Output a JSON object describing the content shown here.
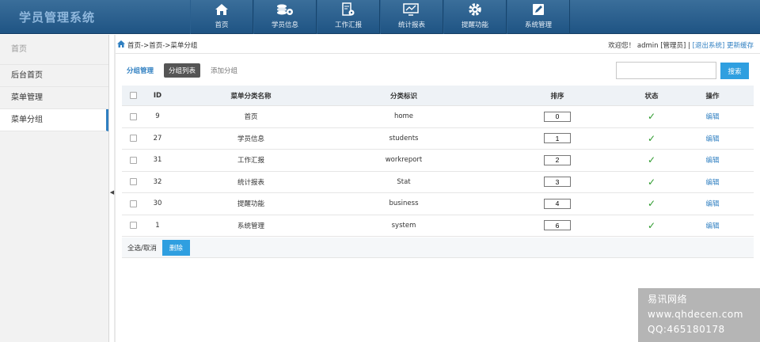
{
  "header": {
    "app_title": "学员管理系统",
    "nav": [
      {
        "label": "首页",
        "icon": "home-icon"
      },
      {
        "label": "学员信息",
        "icon": "coins-gear-icon"
      },
      {
        "label": "工作汇报",
        "icon": "document-gear-icon"
      },
      {
        "label": "统计报表",
        "icon": "monitor-chart-icon"
      },
      {
        "label": "提醒功能",
        "icon": "gear-icon"
      },
      {
        "label": "系统管理",
        "icon": "edit-icon"
      }
    ]
  },
  "sidebar": {
    "items": [
      "首页",
      "后台首页",
      "菜单管理",
      "菜单分组"
    ],
    "active": "菜单分组"
  },
  "topbar": {
    "breadcrumb": "首页->首页->菜单分组",
    "welcome": "欢迎您！ admin [管理员]",
    "sep": " | ",
    "logout": "[退出系统]",
    "update_cache": "更新缓存"
  },
  "tabs": [
    "分组管理",
    "分组列表",
    "添加分组"
  ],
  "search": {
    "placeholder": "",
    "button": "搜索"
  },
  "table": {
    "headers": [
      "ID",
      "菜单分类名称",
      "分类标识",
      "排序",
      "状态",
      "操作"
    ],
    "rows": [
      {
        "id": "9",
        "name": "首页",
        "flag": "home",
        "sort": "0",
        "status": "enabled",
        "op": "编辑"
      },
      {
        "id": "27",
        "name": "学员信息",
        "flag": "students",
        "sort": "1",
        "status": "enabled",
        "op": "编辑"
      },
      {
        "id": "31",
        "name": "工作汇报",
        "flag": "workreport",
        "sort": "2",
        "status": "enabled",
        "op": "编辑"
      },
      {
        "id": "32",
        "name": "统计报表",
        "flag": "Stat",
        "sort": "3",
        "status": "enabled",
        "op": "编辑"
      },
      {
        "id": "30",
        "name": "提醒功能",
        "flag": "business",
        "sort": "4",
        "status": "enabled",
        "op": "编辑"
      },
      {
        "id": "1",
        "name": "系统管理",
        "flag": "system",
        "sort": "6",
        "status": "enabled",
        "op": "编辑"
      }
    ]
  },
  "footer": {
    "select_all": "全选/取消",
    "delete": "删除"
  },
  "watermark": {
    "line1": "易讯网络",
    "line2": "www.qhdecen.com",
    "line3": "QQ:465180178"
  },
  "colors": {
    "header": "#1f5484",
    "accent": "#2f9fe0",
    "link": "#2f7fc1",
    "check": "#2c9a2c"
  }
}
